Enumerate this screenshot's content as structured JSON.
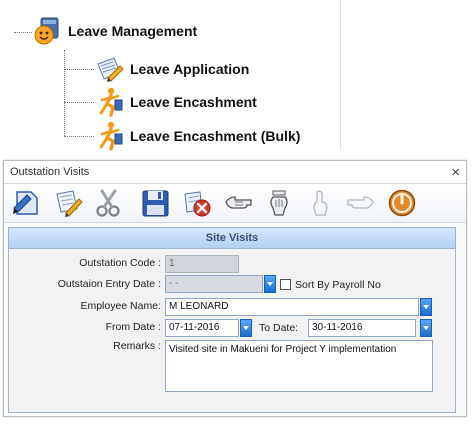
{
  "tree": {
    "root": {
      "label": "Leave Management",
      "icon": "leave-management-icon"
    },
    "children": [
      {
        "label": "Leave Application",
        "icon": "leave-application-icon"
      },
      {
        "label": "Leave Encashment",
        "icon": "leave-encashment-icon"
      },
      {
        "label": "Leave Encashment (Bulk)",
        "icon": "leave-encashment-bulk-icon"
      }
    ]
  },
  "dialog": {
    "title": "Outstation Visits",
    "close_label": "×",
    "toolbar": [
      "new-record-icon",
      "edit-icon",
      "delete-icon",
      "save-icon",
      "cancel-icon",
      "first-record-icon",
      "previous-record-icon",
      "next-record-icon",
      "last-record-icon",
      "exit-icon"
    ],
    "section_title": "Site Visits",
    "fields": {
      "outstation_code": {
        "label": "Outstation Code :",
        "value": "1"
      },
      "entry_date": {
        "label": "Outstaion Entry Date :",
        "value": "- -"
      },
      "sort_by_payroll": {
        "label": "Sort By Payroll No",
        "checked": false
      },
      "employee_name": {
        "label": "Employee Name:",
        "value": "M LEONARD"
      },
      "from_date": {
        "label": "From Date :",
        "value": "07-11-2016"
      },
      "to_date": {
        "label": "To Date:",
        "value": "30-11-2016"
      },
      "remarks": {
        "label": "Remarks :",
        "value": "Visited site in Makueni for Project Y implementation"
      }
    }
  },
  "colors": {
    "accent": "#1d6fd2",
    "panel_header": "#b4d0f3",
    "panel_border": "#9fb4d3"
  }
}
